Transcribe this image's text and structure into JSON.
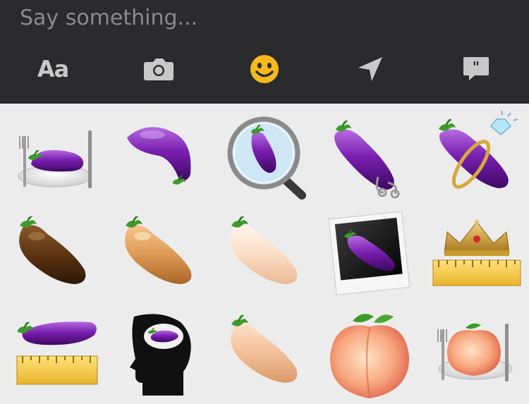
{
  "composer": {
    "placeholder": "Say something...",
    "text_format_label": "Aa"
  },
  "toolbar": {
    "icons": [
      "text-format-icon",
      "camera-icon",
      "smiley-icon",
      "location-arrow-icon",
      "quote-bubble-icon"
    ],
    "active_icon": "smiley-icon",
    "active_color": "#f5b91c",
    "inactive_color": "#c8c8c8",
    "background": "#2b2b2d"
  },
  "sticker_panel": {
    "background": "#ececec",
    "stickers": [
      "eggplant-dinner-plate",
      "eggplant-purple-curved",
      "eggplant-magnifying-glass",
      "eggplant-with-hoop",
      "eggplant-with-ring",
      "eggplant-dark-brown",
      "eggplant-tan",
      "eggplant-light-beige",
      "eggplant-photo-frame",
      "crown-on-ruler",
      "eggplant-on-ruler",
      "eggplant-in-head",
      "eggplant-peach",
      "peach",
      "peach-dinner-plate"
    ]
  }
}
